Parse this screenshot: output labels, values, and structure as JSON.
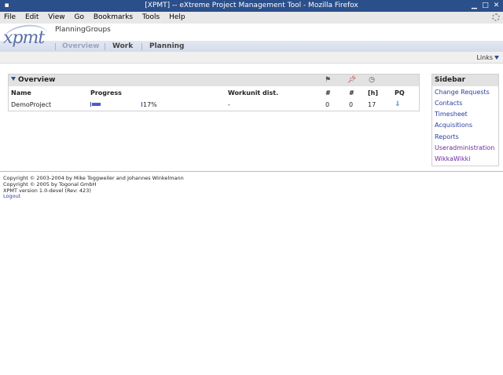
{
  "window": {
    "title": "[XPMT] -- eXtreme Project Management Tool - Mozilla Firefox"
  },
  "menu": [
    "File",
    "Edit",
    "View",
    "Go",
    "Bookmarks",
    "Tools",
    "Help"
  ],
  "app": {
    "logo": "xpmt",
    "name": "PlanningGroups"
  },
  "nav": {
    "overview": "Overview",
    "work": "Work",
    "planning": "Planning"
  },
  "links": {
    "label": "Links"
  },
  "overview": {
    "title": "Overview",
    "columns": {
      "name": "Name",
      "progress": "Progress",
      "workunit": "Workunit dist.",
      "count1": "#",
      "count2": "#",
      "hours": "[h]",
      "pq": "PQ"
    },
    "rows": [
      {
        "name": "DemoProject",
        "progress": 0.17,
        "progress_label": "17%",
        "workunit": "-",
        "count1": "0",
        "count2": "0",
        "hours": "17"
      }
    ],
    "icons": [
      "flag-icon",
      "pin-icon",
      "clock-icon"
    ],
    "progress_color": "#4a5cc8"
  },
  "sidebar": {
    "title": "Sidebar",
    "items": [
      {
        "label": "Change Requests"
      },
      {
        "label": "Contacts"
      },
      {
        "label": "Timesheet"
      },
      {
        "label": "Acquisitions"
      },
      {
        "label": "Reports"
      },
      {
        "label": "Useradministration"
      },
      {
        "label": "WikkaWikki"
      }
    ]
  },
  "footer": {
    "line1": "Copyright © 2003-2004 by Mike Toggweiler and Johannes Winkelmann",
    "line2": "Copyright © 2005 by Togonal GmbH",
    "line3": "XPMT version 1.0-devel (Rev: 423)",
    "logout": "Logout"
  }
}
